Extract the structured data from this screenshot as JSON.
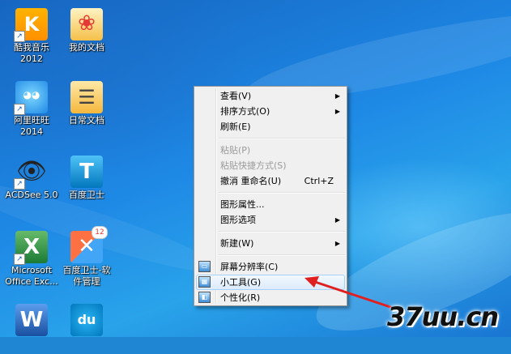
{
  "desktop_icons": [
    {
      "label": "酷我音乐\n2012",
      "icon": "kuwo-music-icon"
    },
    {
      "label": "我的文档",
      "icon": "my-documents-icon"
    },
    {
      "label": "阿里旺旺\n2014",
      "icon": "aliwangwang-icon"
    },
    {
      "label": "日常文档",
      "icon": "daily-documents-icon"
    },
    {
      "label": "ACDSee 5.0",
      "icon": "acdsee-icon"
    },
    {
      "label": "百度卫士",
      "icon": "baidu-guard-icon"
    },
    {
      "label": "Microsoft\nOffice Exc...",
      "icon": "excel-icon"
    },
    {
      "label": "百度卫士-软\n件管理",
      "icon": "software-manager-icon",
      "badge": "12"
    },
    {
      "label": "",
      "icon": "word-icon"
    },
    {
      "label": "",
      "icon": "baidu-du-icon"
    }
  ],
  "context_menu": {
    "view": "查看(V)",
    "sort": "排序方式(O)",
    "refresh": "刷新(E)",
    "paste": "粘贴(P)",
    "paste_shortcut": "粘贴快捷方式(S)",
    "undo_rename": "撤消 重命名(U)",
    "undo_shortcut": "Ctrl+Z",
    "graphics_properties": "图形属性...",
    "graphics_options": "图形选项",
    "new": "新建(W)",
    "screen_resolution": "屏幕分辨率(C)",
    "gadgets": "小工具(G)",
    "personalize": "个性化(R)"
  },
  "watermark": "37uu.cn",
  "colors": {
    "menu_bg": "#f0f0f0",
    "hover_bg": "#dcebfc",
    "arrow_red": "#e02020"
  }
}
